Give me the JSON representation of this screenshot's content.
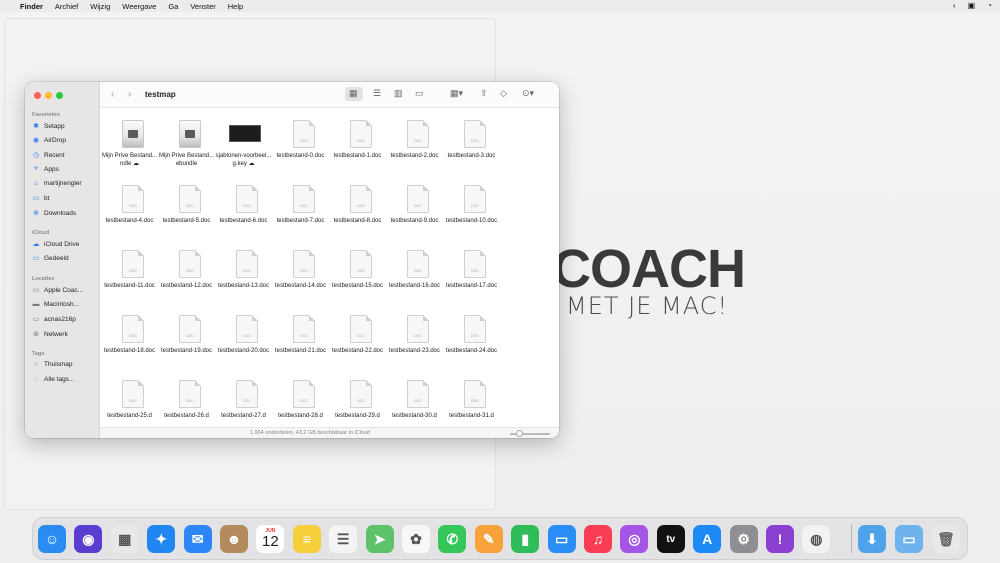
{
  "menubar": {
    "app": "Finder",
    "items": [
      "Archief",
      "Wijzig",
      "Weergave",
      "Ga",
      "Venster",
      "Help"
    ]
  },
  "desktop": {
    "brand_big": "COACH",
    "brand_sub": "MET JE MAC!"
  },
  "window": {
    "title": "testmap",
    "status": "1.004 onderdelen, 43,2 GB beschikbaar in iCloud"
  },
  "sidebar": {
    "favorites_title": "Favorieten",
    "favorites": [
      {
        "label": "Setapp",
        "icon": "setapp-icon"
      },
      {
        "label": "AirDrop",
        "icon": "airdrop-icon"
      },
      {
        "label": "Recent",
        "icon": "clock-icon"
      },
      {
        "label": "Apps",
        "icon": "apps-icon"
      },
      {
        "label": "martijnengler",
        "icon": "home-icon"
      },
      {
        "label": "bt",
        "icon": "folder-icon"
      },
      {
        "label": "Downloads",
        "icon": "download-icon"
      }
    ],
    "icloud_title": "iCloud",
    "icloud": [
      {
        "label": "iCloud Drive",
        "icon": "cloud-icon"
      },
      {
        "label": "Gedeeld",
        "icon": "shared-folder-icon"
      }
    ],
    "locations_title": "Locaties",
    "locations": [
      {
        "label": "Apple Coac...",
        "icon": "laptop-icon"
      },
      {
        "label": "Macintosh...",
        "icon": "disk-icon"
      },
      {
        "label": "acnas216p",
        "icon": "monitor-icon"
      },
      {
        "label": "Netwerk",
        "icon": "network-icon"
      }
    ],
    "tags_title": "Tags",
    "tags": [
      {
        "label": "Thuismap",
        "icon": "tag-icon"
      },
      {
        "label": "Alle tags...",
        "icon": "tags-icon"
      }
    ]
  },
  "files": [
    {
      "kind": "disk",
      "label": "Mijn Prive Bestand...ndle ☁"
    },
    {
      "kind": "disk",
      "label": "Mijn Prive Bestand...ebundle"
    },
    {
      "kind": "key",
      "label": "sjablonen-voorbeel...g.key ☁"
    },
    {
      "kind": "doc",
      "label": "testbestand-0.doc"
    },
    {
      "kind": "doc",
      "label": "testbestand-1.doc"
    },
    {
      "kind": "doc",
      "label": "testbestand-2.doc"
    },
    {
      "kind": "doc",
      "label": "testbestand-3.doc"
    },
    {
      "kind": "doc",
      "label": "testbestand-4.doc"
    },
    {
      "kind": "doc",
      "label": "testbestand-5.doc"
    },
    {
      "kind": "doc",
      "label": "testbestand-6.doc"
    },
    {
      "kind": "doc",
      "label": "testbestand-7.doc"
    },
    {
      "kind": "doc",
      "label": "testbestand-8.doc"
    },
    {
      "kind": "doc",
      "label": "testbestand-9.doc"
    },
    {
      "kind": "doc",
      "label": "testbestand-10.doc"
    },
    {
      "kind": "doc",
      "label": "testbestand-11.doc"
    },
    {
      "kind": "doc",
      "label": "testbestand-12.doc"
    },
    {
      "kind": "doc",
      "label": "testbestand-13.doc"
    },
    {
      "kind": "doc",
      "label": "testbestand-14.doc"
    },
    {
      "kind": "doc",
      "label": "testbestand-15.doc"
    },
    {
      "kind": "doc",
      "label": "testbestand-16.doc"
    },
    {
      "kind": "doc",
      "label": "testbestand-17.doc"
    },
    {
      "kind": "doc",
      "label": "testbestand-18.doc"
    },
    {
      "kind": "doc",
      "label": "testbestand-19.doc"
    },
    {
      "kind": "doc",
      "label": "testbestand-20.doc"
    },
    {
      "kind": "doc",
      "label": "testbestand-21.doc"
    },
    {
      "kind": "doc",
      "label": "testbestand-22.doc"
    },
    {
      "kind": "doc",
      "label": "testbestand-23.doc"
    },
    {
      "kind": "doc",
      "label": "testbestand-24.doc"
    },
    {
      "kind": "doc",
      "label": "testbestand-25.d"
    },
    {
      "kind": "doc",
      "label": "testbestand-26.d"
    },
    {
      "kind": "doc",
      "label": "testbestand-27.d"
    },
    {
      "kind": "doc",
      "label": "testbestand-28.d"
    },
    {
      "kind": "doc",
      "label": "testbestand-29.d"
    },
    {
      "kind": "doc",
      "label": "testbestand-30.d"
    },
    {
      "kind": "doc",
      "label": "testbestand-31.d"
    }
  ],
  "doc_tag": "DOC",
  "dock": {
    "calendar_month": "JUN",
    "calendar_day": "12",
    "apps": [
      {
        "name": "finder-icon",
        "color": "#2a8cf0",
        "glyph": "☺"
      },
      {
        "name": "siri-icon",
        "color": "#5b3dcf",
        "glyph": "◉"
      },
      {
        "name": "launchpad-icon",
        "color": "#e8e8ea",
        "glyph": "▦"
      },
      {
        "name": "safari-icon",
        "color": "#1f86f2",
        "glyph": "✦"
      },
      {
        "name": "mail-icon",
        "color": "#2d86f5",
        "glyph": "✉"
      },
      {
        "name": "contacts-icon",
        "color": "#b38b5d",
        "glyph": "☻"
      },
      {
        "name": "calendar-icon",
        "color": "#ffffff",
        "glyph": ""
      },
      {
        "name": "notes-icon",
        "color": "#f6cf3d",
        "glyph": "≡"
      },
      {
        "name": "reminders-icon",
        "color": "#f4f4f4",
        "glyph": "☰"
      },
      {
        "name": "maps-icon",
        "color": "#5ec26a",
        "glyph": "➤"
      },
      {
        "name": "photos-icon",
        "color": "#f7f7f7",
        "glyph": "✿"
      },
      {
        "name": "messages-icon",
        "color": "#35c759",
        "glyph": "✆"
      },
      {
        "name": "pages-icon",
        "color": "#f7a23a",
        "glyph": "✎"
      },
      {
        "name": "numbers-icon",
        "color": "#2fbd5a",
        "glyph": "▮"
      },
      {
        "name": "keynote-icon",
        "color": "#2a8df5",
        "glyph": "▭"
      },
      {
        "name": "music-icon",
        "color": "#fa3c55",
        "glyph": "♫"
      },
      {
        "name": "podcasts-icon",
        "color": "#a455e6",
        "glyph": "◎"
      },
      {
        "name": "apple-tv-icon",
        "color": "#111111",
        "glyph": "tv"
      },
      {
        "name": "app-store-icon",
        "color": "#1d8af5",
        "glyph": "A"
      },
      {
        "name": "system-preferences-icon",
        "color": "#8e8e93",
        "glyph": "⚙"
      },
      {
        "name": "feedback-assistant-icon",
        "color": "#8a3fd1",
        "glyph": "!"
      },
      {
        "name": "chrome-icon",
        "color": "#f2f2f2",
        "glyph": "◍"
      }
    ],
    "extras": [
      {
        "name": "downloads-stack-icon",
        "color": "#4fa3ea",
        "glyph": "⬇"
      },
      {
        "name": "folder-stack-icon",
        "color": "#6eb2ee",
        "glyph": "▭"
      },
      {
        "name": "trash-icon",
        "color": "#e8e8ea",
        "glyph": "🗑"
      }
    ]
  }
}
